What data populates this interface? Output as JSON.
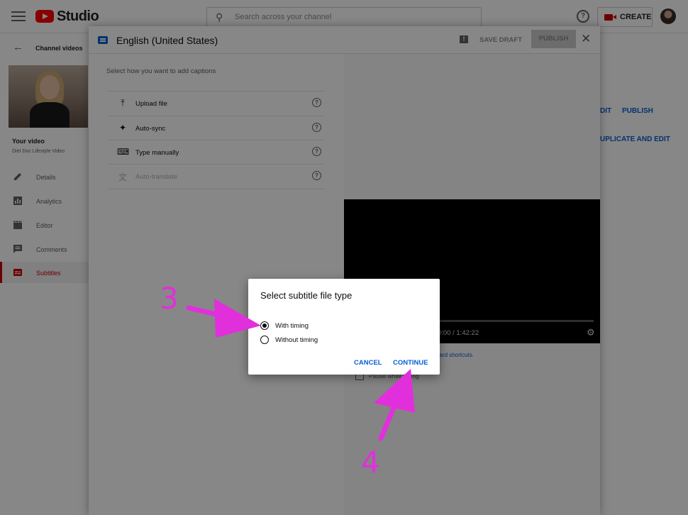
{
  "topbar": {
    "logo_text": "Studio",
    "search_placeholder": "Search across your channel",
    "create_label": "CREATE",
    "help_glyph": "?"
  },
  "sidebar": {
    "back_label": "Channel videos",
    "your_video_label": "Your video",
    "video_name": "Diet Doc Lifestyle Video",
    "items": [
      {
        "label": "Details",
        "icon": "pencil-icon"
      },
      {
        "label": "Analytics",
        "icon": "analytics-icon"
      },
      {
        "label": "Editor",
        "icon": "clapper-icon"
      },
      {
        "label": "Comments",
        "icon": "comment-icon"
      },
      {
        "label": "Subtitles",
        "icon": "subtitles-icon",
        "active": true
      }
    ]
  },
  "page_behind": {
    "edit_label": "DIT",
    "publish_label": "PUBLISH",
    "duplicate_label": "UPLICATE AND EDIT"
  },
  "panel": {
    "title": "English (United States)",
    "save_draft_label": "SAVE DRAFT",
    "publish_label": "PUBLISH",
    "prompt": "Select how you want to add captions",
    "options": [
      {
        "label": "Upload file",
        "icon": "upload-icon",
        "disabled": false
      },
      {
        "label": "Auto-sync",
        "icon": "sparkle-icon",
        "disabled": false
      },
      {
        "label": "Type manually",
        "icon": "keyboard-icon",
        "disabled": false
      },
      {
        "label": "Auto-translate",
        "icon": "translate-icon",
        "disabled": true
      }
    ],
    "player_time": "0:00 / 1:42:22",
    "keyboard_link": "oard shortcuts.",
    "pause_label": "Pause while typing"
  },
  "dialog": {
    "title": "Select subtitle file type",
    "options": [
      {
        "label": "With timing",
        "selected": true
      },
      {
        "label": "Without timing",
        "selected": false
      }
    ],
    "cancel_label": "CANCEL",
    "continue_label": "CONTINUE"
  },
  "annotations": {
    "step_3": "3",
    "step_4": "4",
    "color": "#e22fdc"
  },
  "colors": {
    "accent_blue": "#065fd4",
    "brand_red": "#ff0000",
    "active_red": "#cc0000"
  }
}
